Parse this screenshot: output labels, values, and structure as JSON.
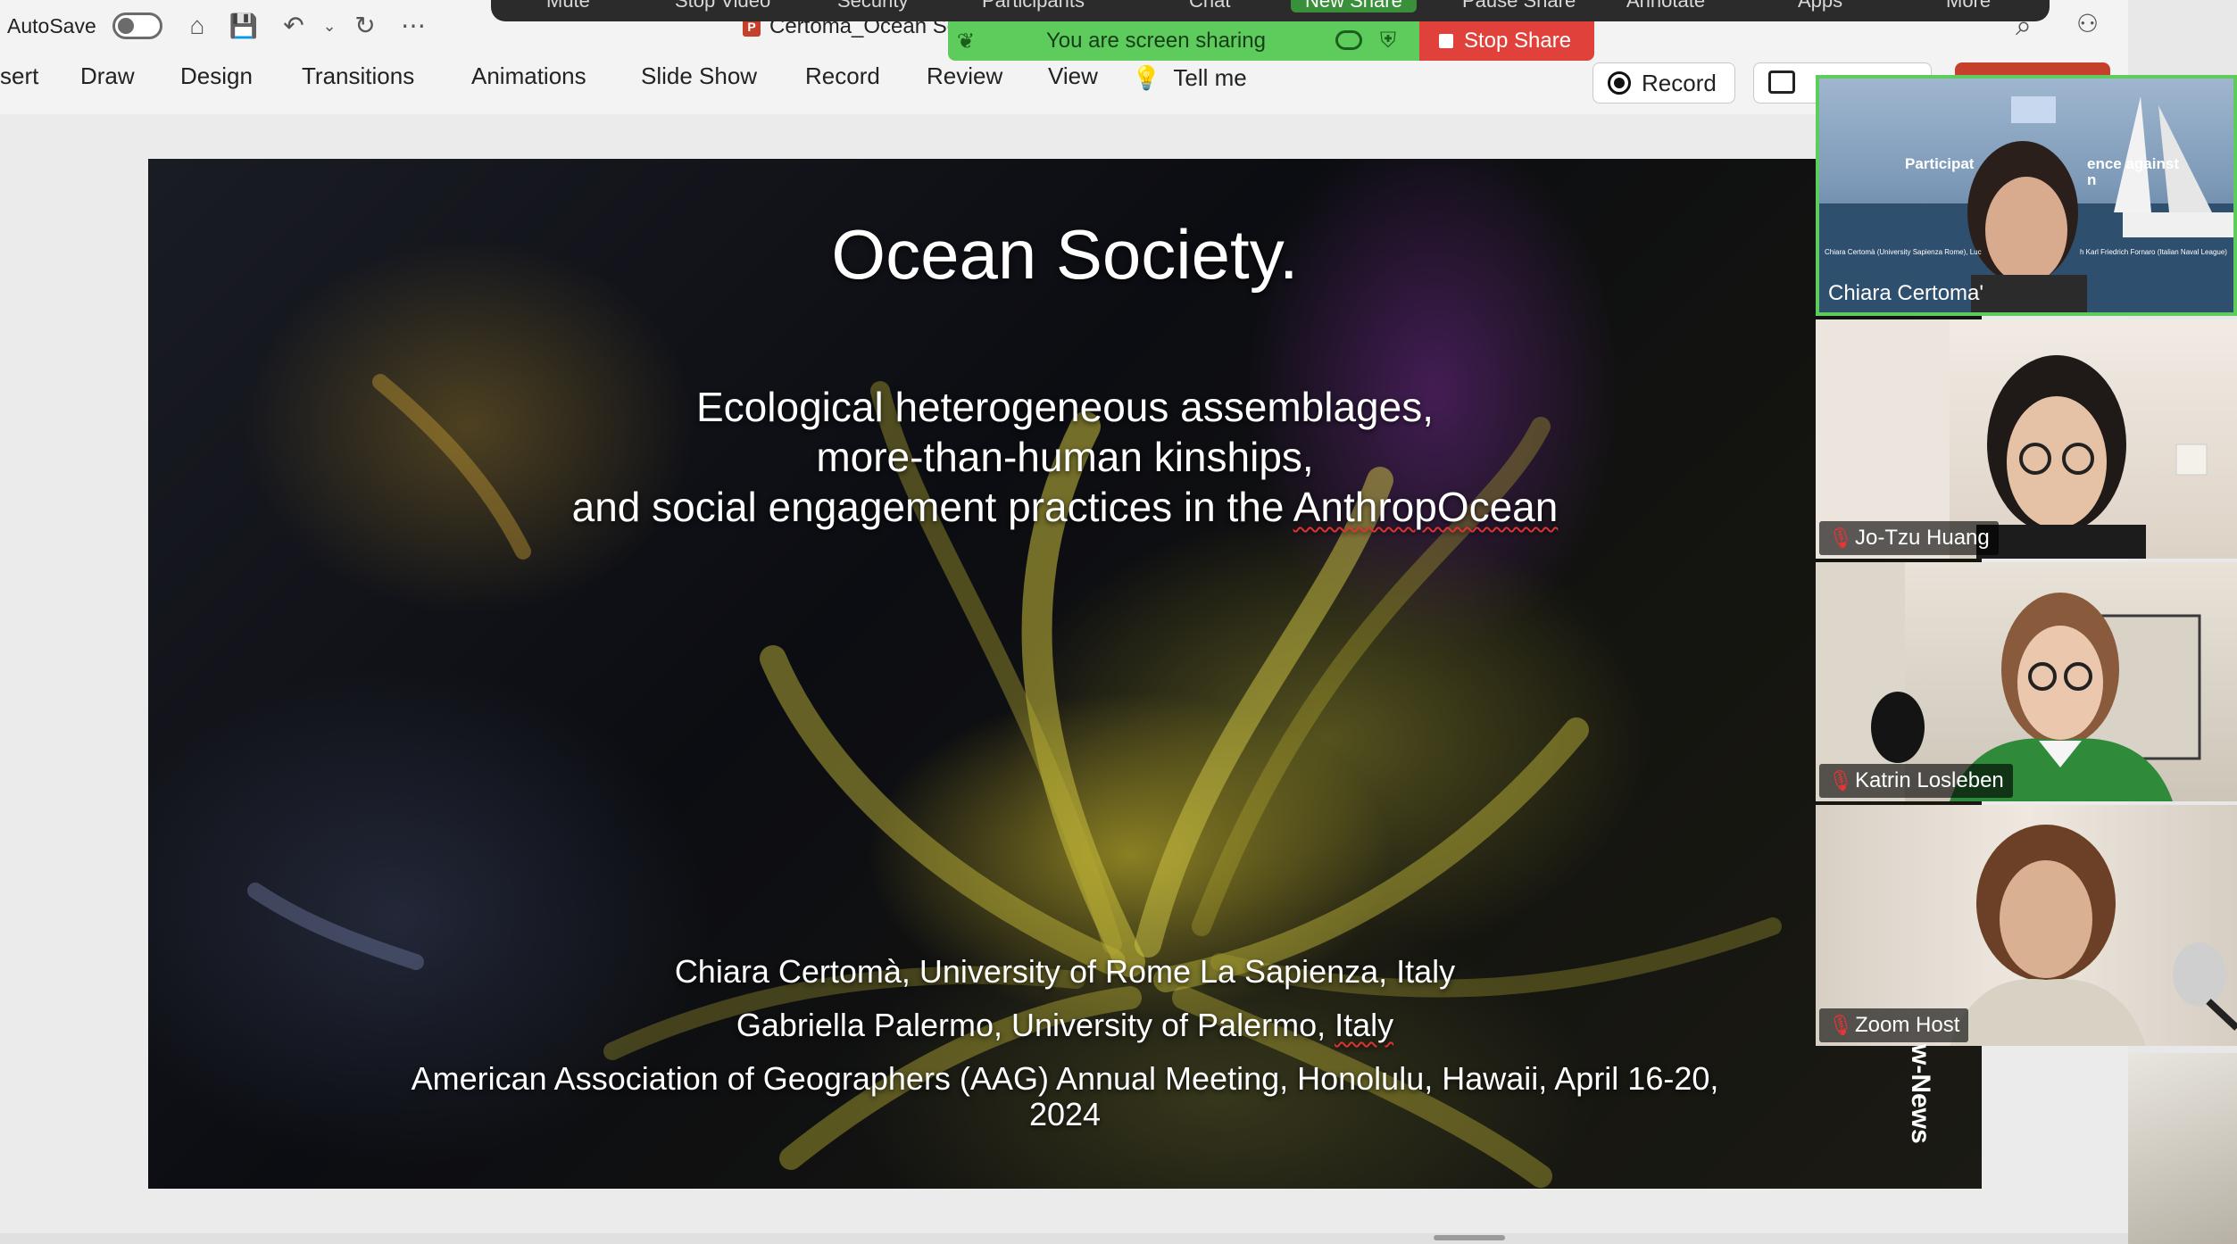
{
  "ppt": {
    "autosave_label": "AutoSave",
    "doc_title": "Certoma_Ocean Soc",
    "ribbon_tabs": [
      "sert",
      "Draw",
      "Design",
      "Transitions",
      "Animations",
      "Slide Show",
      "Record",
      "Review",
      "View"
    ],
    "tell_me": "Tell me",
    "record_button": "Record"
  },
  "zoom": {
    "toolbar_items": [
      "Mute",
      "Stop Video",
      "Security",
      "Participants",
      "Chat",
      "New Share",
      "Pause Share",
      "Annotate",
      "Apps",
      "More"
    ],
    "sharing_text": "You are screen sharing",
    "stop_share": "Stop Share",
    "colors": {
      "share_green": "#5dcc5d",
      "stop_red": "#e0413a"
    }
  },
  "slide": {
    "title": "Ocean Society.",
    "subtitle_lines": [
      "Ecological heterogeneous assemblages,",
      "more-than-human kinships,",
      "and social engagement  practices in the "
    ],
    "subtitle_squiggle": "AnthropOcean",
    "author1": "Chiara Certomà, University of Rome La Sapienza, Italy",
    "author2_prefix": "Gabriella Palermo, University of Palermo, ",
    "author2_squiggle": "Italy",
    "conference": "American Association of Geographers (AAG) Annual Meeting, Honolulu, Hawaii, April 16-20,",
    "year": "2024",
    "side_text": "w-News"
  },
  "participants": [
    {
      "name": "Chiara Certoma'",
      "muted": false,
      "active": true,
      "shared_screen_text": "Participat",
      "shared_screen_text2": "ence against",
      "shared_screen_text3": "n",
      "caption_left": "Chiara Certomà (University Sapienza Rome), Luc",
      "caption_right": "h Karl Friedrich Fornaro (Italian Naval League)"
    },
    {
      "name": "Jo-Tzu Huang",
      "muted": true,
      "active": false
    },
    {
      "name": "Katrin Losleben",
      "muted": true,
      "active": false
    },
    {
      "name": "Zoom Host",
      "muted": true,
      "active": false
    }
  ]
}
